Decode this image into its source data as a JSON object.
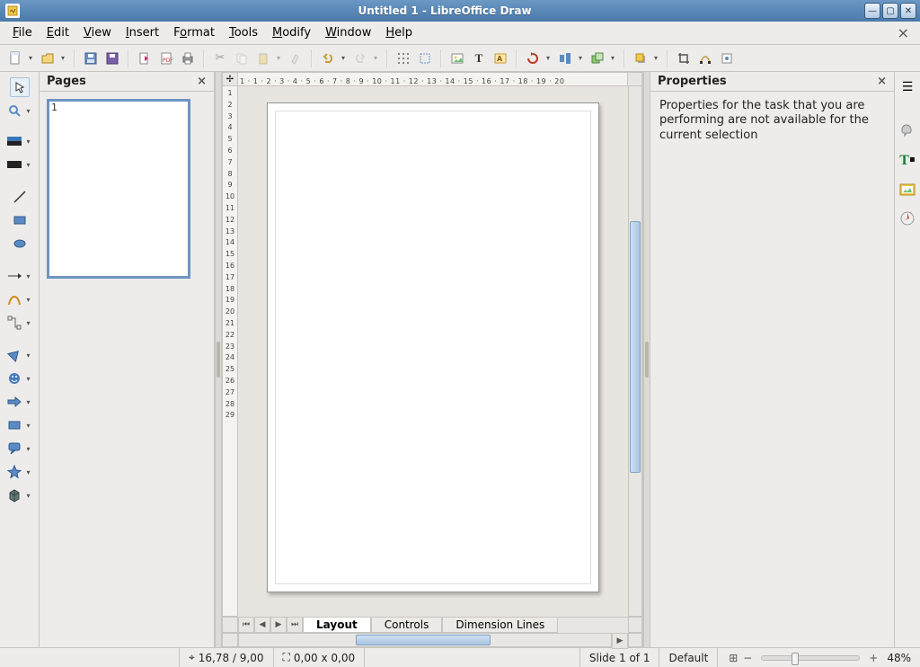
{
  "window": {
    "title": "Untitled 1 - LibreOffice Draw"
  },
  "menu": {
    "items": [
      "File",
      "Edit",
      "View",
      "Insert",
      "Format",
      "Tools",
      "Modify",
      "Window",
      "Help"
    ]
  },
  "pages_panel": {
    "title": "Pages",
    "page_number": "1"
  },
  "properties_panel": {
    "title": "Properties",
    "message": "Properties for the task that you are performing are not available for the current selection"
  },
  "tabs": {
    "items": [
      "Layout",
      "Controls",
      "Dimension Lines"
    ],
    "active_index": 0
  },
  "statusbar": {
    "cursor_pos": "16,78 / 9,00",
    "object_size": "0,00 x 0,00",
    "slide_info": "Slide 1 of 1",
    "page_style": "Default",
    "zoom_value": "48%"
  },
  "ruler_h_text": "1 · 1 · 2 · 3 · 4 · 5 · 6 · 7 · 8 · 9 · 10 · 11 · 12 · 13 · 14 · 15 · 16 · 17 · 18 · 19 · 20",
  "ruler_v_values": [
    "1",
    "2",
    "3",
    "4",
    "5",
    "6",
    "7",
    "8",
    "9",
    "10",
    "11",
    "12",
    "13",
    "14",
    "15",
    "16",
    "17",
    "18",
    "19",
    "20",
    "21",
    "22",
    "23",
    "24",
    "25",
    "26",
    "27",
    "28",
    "29"
  ]
}
